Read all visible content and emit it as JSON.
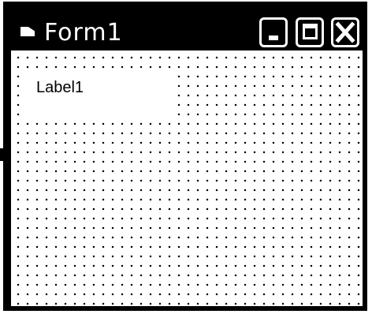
{
  "window": {
    "title": "Form1",
    "icon": "form-icon",
    "controls": {
      "minimize": "minimize-icon",
      "maximize": "maximize-icon",
      "close": "close-icon"
    }
  },
  "form": {
    "grid": "dotted",
    "label": {
      "text": "Label1"
    }
  },
  "colors": {
    "titlebar": "#000000",
    "title_text": "#ffffff",
    "client": "#ffffff",
    "grid_dots": "#000000"
  }
}
